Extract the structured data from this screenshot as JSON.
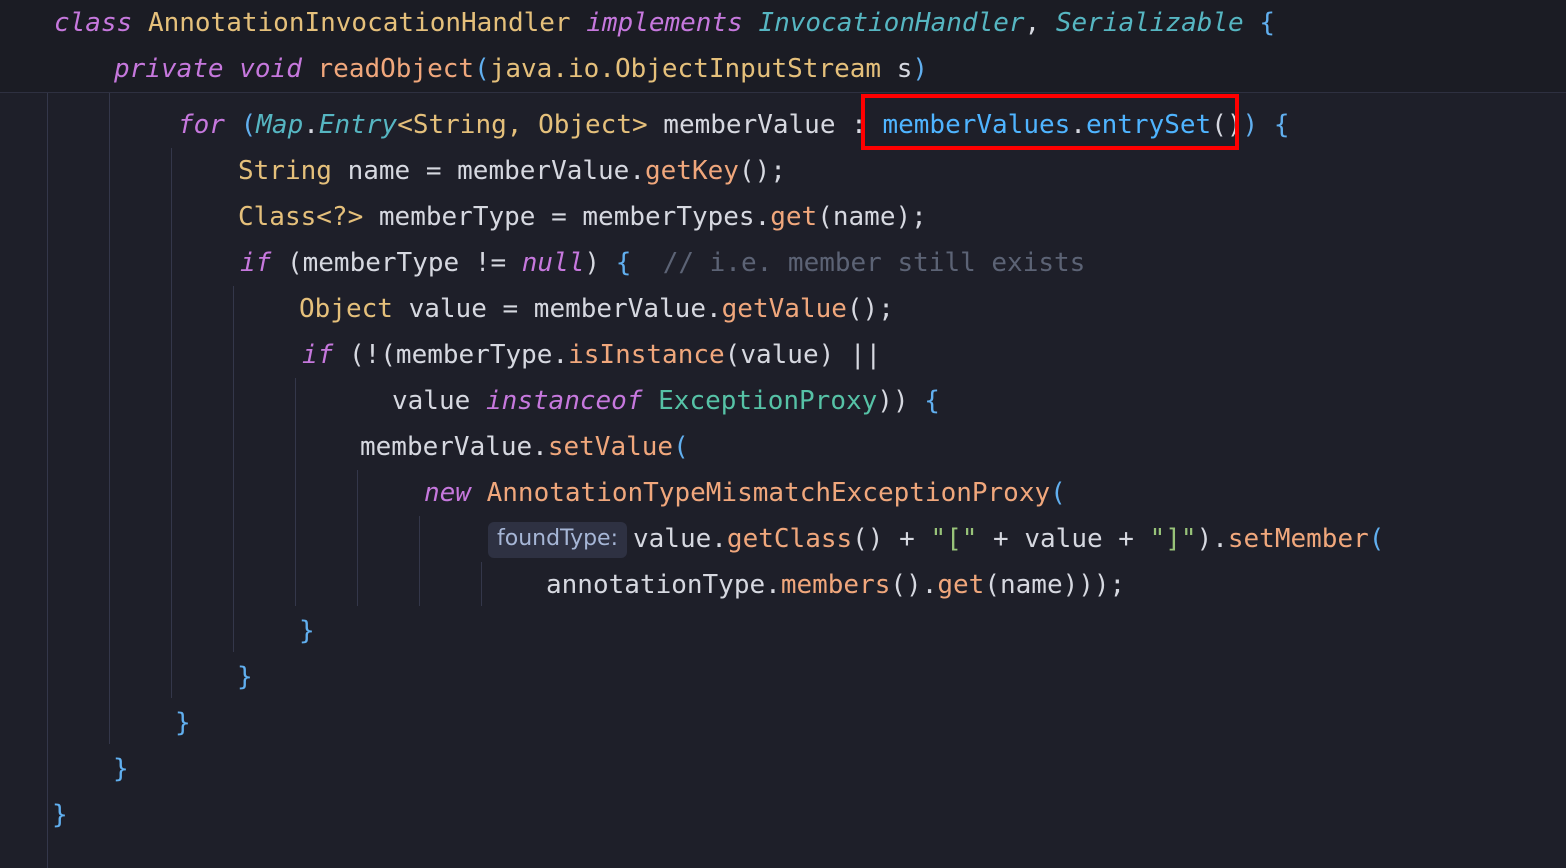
{
  "sticky_scroll": {
    "line1": {
      "kw_class": "class",
      "class_name": "AnnotationInvocationHandler",
      "kw_implements": "implements",
      "iface1": "InvocationHandler",
      "comma": ",",
      "iface2": "Serializable",
      "brace": "{"
    },
    "line2": {
      "kw_private": "private",
      "kw_void": "void",
      "method": "readObject",
      "open": "(",
      "param_type": "java.io.ObjectInputStream",
      "param_name": "s",
      "close": ")"
    }
  },
  "code": {
    "for_line": {
      "kw_for": "for",
      "open": "(",
      "map": "Map",
      "dot": ".",
      "entry": "Entry",
      "generic": "<String, Object>",
      "var": "memberValue",
      "colon": ":",
      "target": "memberValues",
      "dot2": ".",
      "call": "entrySet",
      "parens": "()",
      "close": ")",
      "brace": "{"
    },
    "name_line": {
      "type": "String",
      "rest": "name = memberValue.",
      "call": "getKey",
      "end": "();"
    },
    "member_type_line": {
      "type": "Class",
      "generic": "<?>",
      "rest": "memberType = memberTypes.",
      "call": "get",
      "end": "(name);"
    },
    "if_line": {
      "kw_if": "if",
      "cond": "(memberType != ",
      "kw_null": "null",
      "close": ")",
      "brace": "{",
      "comment": "// i.e. member still exists"
    },
    "value_line": {
      "type": "Object",
      "rest": "value = memberValue.",
      "call": "getValue",
      "end": "();"
    },
    "if2_line": {
      "kw_if": "if",
      "open": "(!(memberType.",
      "call": "isInstance",
      "rest": "(value) ||"
    },
    "instanceof_line": {
      "lhs": "value",
      "kw_instanceof": "instanceof",
      "type": "ExceptionProxy",
      "close": "))",
      "brace": "{"
    },
    "setvalue_line": {
      "obj": "memberValue.",
      "call": "setValue",
      "open": "("
    },
    "new_line": {
      "kw_new": "new",
      "type": "AnnotationTypeMismatchExceptionProxy",
      "open": "("
    },
    "found_line": {
      "hint": "foundType:",
      "lhs": "value.",
      "call1": "getClass",
      "mid1": "() + ",
      "str1": "\"[\"",
      "mid2": " + value + ",
      "str2": "\"]\"",
      "mid3": ").",
      "call2": "setMember",
      "open": "("
    },
    "annot_line": {
      "obj": "annotationType.",
      "call1": "members",
      "mid": "().",
      "call2": "get",
      "end": "(name)));"
    },
    "closing_braces": [
      "}",
      "}",
      "}",
      "}",
      "}"
    ]
  }
}
